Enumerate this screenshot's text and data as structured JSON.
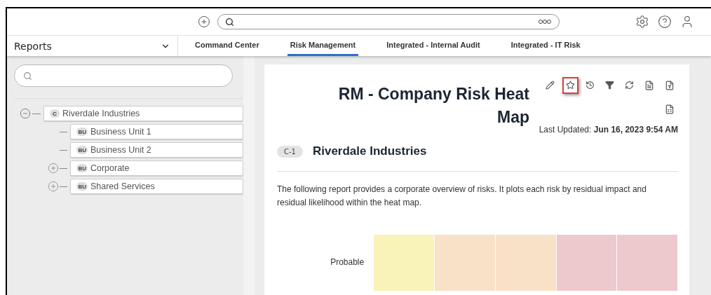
{
  "nav": {
    "module": "Reports",
    "tabs": [
      {
        "label": "Command Center",
        "selected": false
      },
      {
        "label": "Risk Management",
        "selected": true
      },
      {
        "label": "Integrated - Internal Audit",
        "selected": false
      },
      {
        "label": "Integrated - IT Risk",
        "selected": false
      }
    ]
  },
  "tree": [
    {
      "label": "Riverdale Industries",
      "badge": "C",
      "kind": "branch",
      "expanded": true,
      "children": [
        {
          "label": "Business Unit 1",
          "badge": "BU",
          "kind": "leaf"
        },
        {
          "label": "Business Unit 2",
          "badge": "BU",
          "kind": "leaf"
        },
        {
          "label": "Corporate",
          "badge": "BU",
          "kind": "branch",
          "expanded": false
        },
        {
          "label": "Shared Services",
          "badge": "BU",
          "kind": "branch",
          "expanded": false
        }
      ]
    }
  ],
  "report": {
    "title": "RM - Company Risk Heat Map",
    "toolbar": [
      {
        "kind": "edit",
        "highlighted": false
      },
      {
        "kind": "favorite",
        "highlighted": true
      },
      {
        "kind": "history",
        "highlighted": false
      },
      {
        "kind": "filter",
        "highlighted": false
      },
      {
        "kind": "refresh",
        "highlighted": false
      },
      {
        "kind": "pdf",
        "highlighted": false
      },
      {
        "kind": "word",
        "highlighted": false
      },
      {
        "kind": "excel",
        "highlighted": false
      }
    ],
    "updated_label": "Last Updated:",
    "updated_value": "Jun 16, 2023 9:54 AM",
    "section_code": "C-1",
    "section_title": "Riverdale Industries",
    "description": "The following report provides a corporate overview of risks. It plots each risk by residual impact and residual likelihood within the heat map.",
    "heatmap": [
      {
        "label": "Probable",
        "cells": [
          {
            "color": "#f9f2b9"
          },
          {
            "color": "#f9e1c7"
          },
          {
            "color": "#f9e1c7"
          },
          {
            "color": "#edc8cc"
          },
          {
            "color": "#edc8cc"
          }
        ]
      }
    ]
  }
}
